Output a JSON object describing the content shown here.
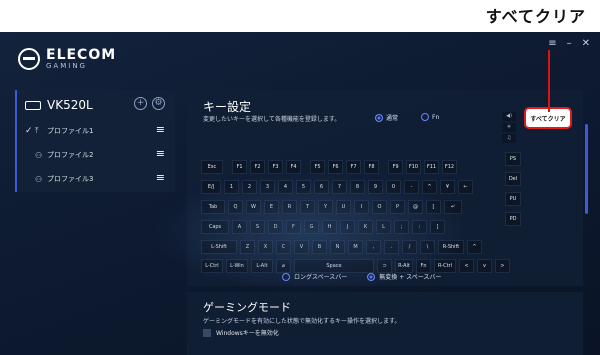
{
  "annotation": {
    "callout": "すべてクリア"
  },
  "app": {
    "brand": "ELECOM",
    "brand_sub": "GAMING"
  },
  "window": {
    "menu": "≡",
    "minimize": "–",
    "close": "✕"
  },
  "device": {
    "name": "VK520L",
    "profiles": [
      {
        "label": "プロファイル1",
        "active": true
      },
      {
        "label": "プロファイル2",
        "active": false
      },
      {
        "label": "プロファイル3",
        "active": false
      }
    ]
  },
  "key_settings": {
    "title": "キー設定",
    "description": "変更したいキーを選択して各種機能を登録します。",
    "mode_normal": "通常",
    "mode_fn": "Fn",
    "clear_all": "すべてクリア",
    "rows": [
      [
        "Esc",
        "F1",
        "F2",
        "F3",
        "F4",
        "F5",
        "F6",
        "F7",
        "F8",
        "F9",
        "F10",
        "F11",
        "F12"
      ],
      [
        "E/J",
        "1",
        "2",
        "3",
        "4",
        "5",
        "6",
        "7",
        "8",
        "9",
        "0",
        "-",
        "^",
        "¥",
        "←"
      ],
      [
        "Tab",
        "Q",
        "W",
        "E",
        "R",
        "T",
        "Y",
        "U",
        "I",
        "O",
        "P",
        "@",
        "["
      ],
      [
        "Caps",
        "A",
        "S",
        "D",
        "F",
        "G",
        "H",
        "J",
        "K",
        "L",
        ";",
        ":",
        "]"
      ],
      [
        "L-Shift",
        "Z",
        "X",
        "C",
        "V",
        "B",
        "N",
        "M",
        ",",
        ".",
        "/",
        "\\",
        "R-Shift",
        "^"
      ],
      [
        "L-Ctrl",
        "L-Win",
        "L-Alt",
        "⌀",
        "Space",
        "⊃",
        "R-Alt",
        "Fn",
        "R-Ctrl",
        "<",
        "v",
        ">"
      ]
    ],
    "side_keys": [
      "PS",
      "Del",
      "PU",
      "PD"
    ],
    "side_icons": [
      "◀)",
      "☀",
      "♫"
    ],
    "enter_key": "↵",
    "space_long": "ロングスペースバー",
    "space_henkan": "無変換 + スペースバー"
  },
  "gaming_mode": {
    "title": "ゲーミングモード",
    "description": "ゲーミングモードを有効にした状態で無効化するキー操作を選択します。",
    "win_key": "Windowsキーを無効化"
  }
}
